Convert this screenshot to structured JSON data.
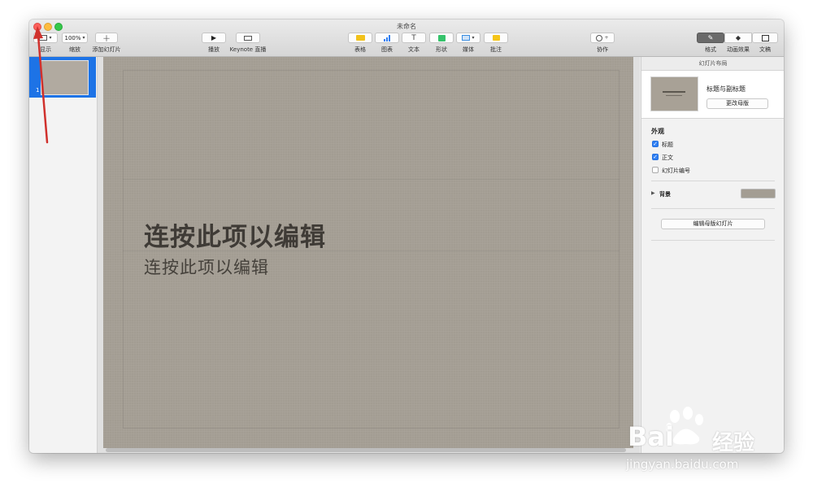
{
  "window": {
    "title": "未命名"
  },
  "toolbar": {
    "view_label": "显示",
    "zoom_value": "100%",
    "zoom_label": "缩放",
    "add_slide_label": "添加幻灯片",
    "play_label": "播放",
    "keynote_live_label": "Keynote 直播",
    "table_label": "表格",
    "chart_label": "图表",
    "text_label": "文本",
    "shape_label": "形状",
    "media_label": "媒体",
    "comment_label": "批注",
    "collaborate_label": "协作",
    "format_label": "格式",
    "animate_label": "动画效果",
    "document_label": "文稿"
  },
  "navigator": {
    "slides": [
      {
        "number": "1"
      }
    ]
  },
  "slide": {
    "title": "连按此项以编辑",
    "subtitle": "连按此项以编辑"
  },
  "inspector": {
    "header": "幻灯片布局",
    "master_name": "标题与副标题",
    "change_master_label": "更改母版",
    "appearance_title": "外观",
    "options": [
      {
        "label": "标题",
        "checked": true
      },
      {
        "label": "正文",
        "checked": true
      },
      {
        "label": "幻灯片编号",
        "checked": false
      }
    ],
    "background_label": "背景",
    "background_color": "#a39d93",
    "edit_master_label": "编辑母版幻灯片"
  },
  "watermark": {
    "brand": "Bai",
    "brand2": "经验",
    "url": "jingyan.baidu.com"
  },
  "colors": {
    "accent": "#1d73e6",
    "annotation_arrow": "#d0312d"
  }
}
